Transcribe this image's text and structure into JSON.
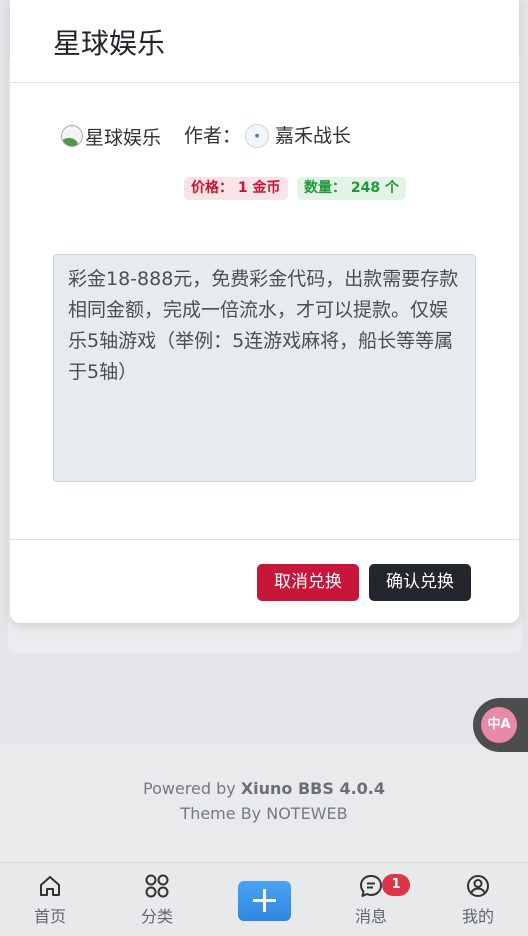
{
  "modal": {
    "title": "星球娱乐",
    "image_alt": "星球娱乐",
    "author_label": "作者：",
    "author_name": "嘉禾战长",
    "price_tag": "价格： 1 金币",
    "quantity_tag": "数量： 248 个",
    "description": "彩金18-888元，免费彩金代码，出款需要存款相同金额，完成一倍流水，才可以提款。仅娱乐5轴游戏（举例：5连游戏麻将，船长等等属于5轴）",
    "cancel_label": "取消兑换",
    "confirm_label": "确认兑换"
  },
  "footer": {
    "powered_prefix": "Powered by ",
    "powered_name": "Xiuno BBS 4.0.4",
    "theme": "Theme By NOTEWEB"
  },
  "bottom_nav": {
    "items": [
      {
        "label": "首页",
        "icon": "home-icon"
      },
      {
        "label": "分类",
        "icon": "grid-icon"
      },
      {
        "label": "",
        "icon": "plus-icon"
      },
      {
        "label": "消息",
        "icon": "chat-icon"
      },
      {
        "label": "我的",
        "icon": "user-icon"
      }
    ],
    "message_badge": "1"
  },
  "translate_button": {
    "icon": "translate-icon"
  },
  "colors": {
    "cancel": "#c8153a",
    "confirm": "#23272b",
    "price_text": "#c5163a",
    "qty_text": "#1e9a3a",
    "plus_button": "#2f88df",
    "badge": "#dc3545"
  }
}
